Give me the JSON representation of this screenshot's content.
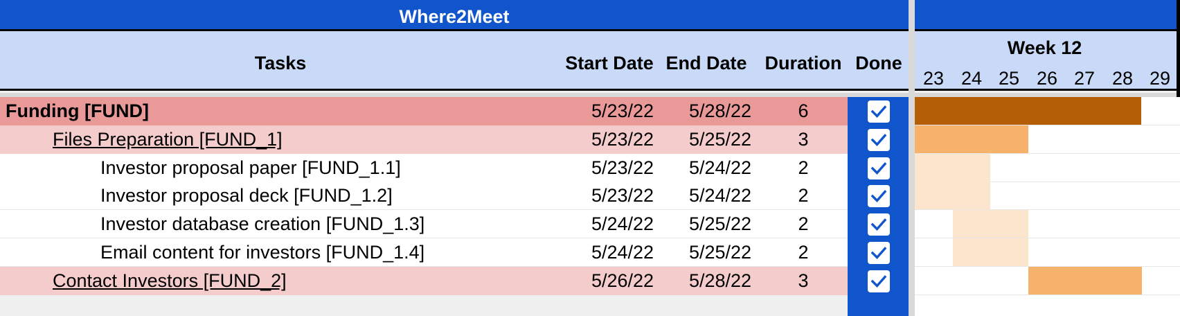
{
  "title": "Where2Meet",
  "headers": {
    "tasks": "Tasks",
    "start": "Start Date",
    "end": "End Date",
    "duration": "Duration",
    "done": "Done"
  },
  "timeline": {
    "week": "Week 12",
    "days": [
      "23",
      "24",
      "25",
      "26",
      "27",
      "28",
      "29"
    ]
  },
  "colors": {
    "header_blue": "#1155cc",
    "header_light": "#c9daf8",
    "level0_row": "#ea9999",
    "level1_row": "#f4cccc",
    "bar_level0": "#b45f06",
    "bar_level1": "#f6b26b",
    "bar_level2": "#fce5cd"
  },
  "rows": [
    {
      "task": "Funding [FUND]",
      "start": "5/23/22",
      "end": "5/28/22",
      "duration": "6",
      "done": true,
      "level": 0,
      "bar_start_day": 23,
      "bar_end_day": 28
    },
    {
      "task": "Files Preparation [FUND_1]",
      "start": "5/23/22",
      "end": "5/25/22",
      "duration": "3",
      "done": true,
      "level": 1,
      "bar_start_day": 23,
      "bar_end_day": 25
    },
    {
      "task": "Investor proposal paper [FUND_1.1]",
      "start": "5/23/22",
      "end": "5/24/22",
      "duration": "2",
      "done": true,
      "level": 2,
      "bar_start_day": 23,
      "bar_end_day": 24
    },
    {
      "task": "Investor proposal deck [FUND_1.2]",
      "start": "5/23/22",
      "end": "5/24/22",
      "duration": "2",
      "done": true,
      "level": 2,
      "bar_start_day": 23,
      "bar_end_day": 24
    },
    {
      "task": "Investor database creation [FUND_1.3]",
      "start": "5/24/22",
      "end": "5/25/22",
      "duration": "2",
      "done": true,
      "level": 2,
      "bar_start_day": 24,
      "bar_end_day": 25
    },
    {
      "task": "Email content for investors [FUND_1.4]",
      "start": "5/24/22",
      "end": "5/25/22",
      "duration": "2",
      "done": true,
      "level": 2,
      "bar_start_day": 24,
      "bar_end_day": 25
    },
    {
      "task": "Contact Investors [FUND_2]",
      "start": "5/26/22",
      "end": "5/28/22",
      "duration": "3",
      "done": true,
      "level": 1,
      "bar_start_day": 26,
      "bar_end_day": 28
    }
  ]
}
